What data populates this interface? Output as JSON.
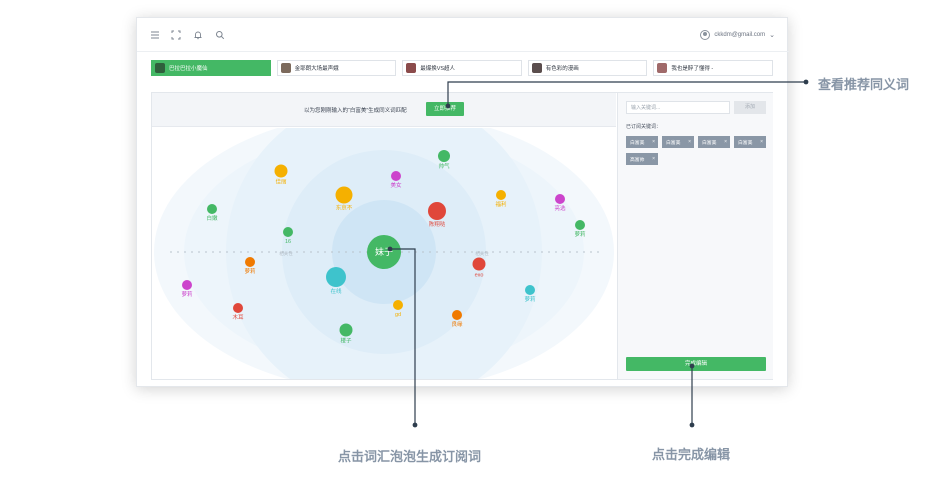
{
  "topbar": {
    "icons": [
      "menu-icon",
      "fullscreen-icon",
      "bell-icon",
      "search-icon"
    ],
    "user_email": "ckkdm@gmail.com"
  },
  "tabs": [
    {
      "label": "巴拉巴拉小魔仙",
      "active": true,
      "thumb_color": "#2f5f3c"
    },
    {
      "label": "金耶朗大场最声娥",
      "active": false,
      "thumb_color": "#7c6a5c"
    },
    {
      "label": "最爆换VS超人",
      "active": false,
      "thumb_color": "#8b4b4b"
    },
    {
      "label": "有色彩的漫画",
      "active": false,
      "thumb_color": "#5a4d4d"
    },
    {
      "label": "我也是醉了懂得 -",
      "active": false,
      "thumb_color": "#a06a6a"
    }
  ],
  "prompt": {
    "text": "以为您刚刚输入的“白富美”生成同义词匹配",
    "recommend_button": "立即推荐"
  },
  "bubbles": {
    "center_label": "妹子",
    "axis_labels": [
      "相关性",
      "相关性"
    ],
    "items": [
      {
        "label": "帅气",
        "color": "#44b865"
      },
      {
        "label": "美女",
        "color": "#cc44cc"
      },
      {
        "label": "佳丽",
        "color": "#f5b000"
      },
      {
        "label": "东京不",
        "color": "#f5b000"
      },
      {
        "label": "陈翔哒",
        "color": "#e0473a"
      },
      {
        "label": "福利",
        "color": "#f5b000"
      },
      {
        "label": "亮选",
        "color": "#cc44cc"
      },
      {
        "label": "白嫩",
        "color": "#44b865"
      },
      {
        "label": "16",
        "color": "#44b865"
      },
      {
        "label": "萝莉",
        "color": "#44b865"
      },
      {
        "label": "萝莉",
        "color": "#f07a00"
      },
      {
        "label": "exo",
        "color": "#e0473a"
      },
      {
        "label": "萝莉",
        "color": "#cc44cc"
      },
      {
        "label": "在线",
        "color": "#3ec3cc"
      },
      {
        "label": "萝莉",
        "color": "#3ec3cc"
      },
      {
        "label": "木耳",
        "color": "#e0473a"
      },
      {
        "label": "gd",
        "color": "#f5b000"
      },
      {
        "label": "良缘",
        "color": "#f07a00"
      },
      {
        "label": "楼子",
        "color": "#44b865"
      }
    ]
  },
  "sidebar": {
    "keyword_placeholder": "输入关键词...",
    "add_button": "添加",
    "subscribed_label": "已订阅关键词：",
    "chips": [
      "白富美",
      "白富美",
      "白富美",
      "白富美",
      "高富帅"
    ],
    "finish_button": "完成编辑"
  },
  "callouts": {
    "recommend": "查看推荐同义词",
    "bubble_click": "点击词汇泡泡生成订阅词",
    "finish": "点击完成编辑"
  },
  "colors": {
    "accent": "#44b865",
    "chip": "#8a97a6",
    "callout_text": "#8795a6",
    "callout_line": "#2e3d4d"
  }
}
